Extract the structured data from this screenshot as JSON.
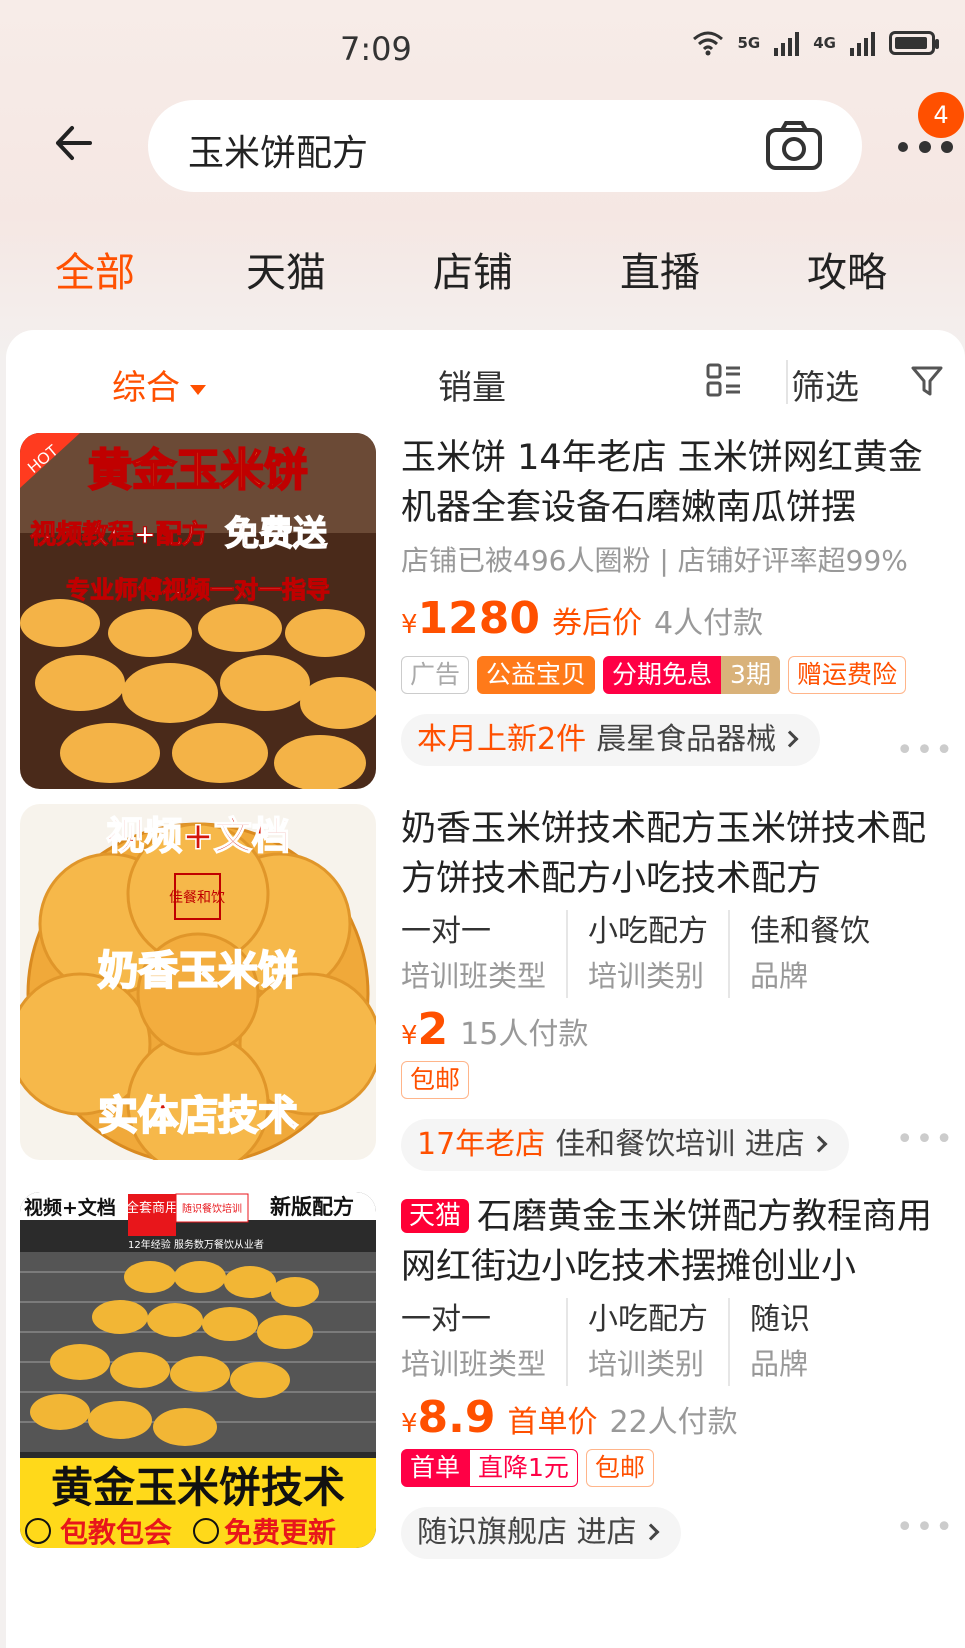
{
  "status": {
    "time": "7:09",
    "net1": "5G",
    "net2": "4G"
  },
  "search": {
    "query": "玉米饼配方",
    "badge": "4"
  },
  "tabs": [
    "全部",
    "天猫",
    "店铺",
    "直播",
    "攻略"
  ],
  "sortbar": {
    "comprehensive": "综合",
    "sales": "销量",
    "filter": "筛选"
  },
  "products": [
    {
      "title": "玉米饼 14年老店 玉米饼网红黄金机器全套设备石磨嫩南瓜饼摆",
      "subline": "店铺已被496人圈粉 | 店铺好评率超99%",
      "yen": "¥",
      "price": "1280",
      "price_label": "券后价",
      "paid": "4人付款",
      "tags": [
        "广告",
        "公益宝贝",
        "分期免息",
        "3期",
        "赠运费险"
      ],
      "shop_highlight": "本月上新2件",
      "shop_name": "晨星食品器械",
      "thumb": {
        "hot": "HOT",
        "line1": "黄金玉米饼",
        "line2a": "视频教程+配方",
        "line2b": "免费送",
        "line3": "专业师傅视频一对一指导"
      }
    },
    {
      "title": "奶香玉米饼技术配方玉米饼技术配方饼技术配方小吃技术配方",
      "attrs": [
        {
          "v": "一对一",
          "k": "培训班类型"
        },
        {
          "v": "小吃配方",
          "k": "培训类别"
        },
        {
          "v": "佳和餐饮",
          "k": "品牌"
        }
      ],
      "yen": "¥",
      "price": "2",
      "paid": "15人付款",
      "tags": [
        "包邮"
      ],
      "shop_highlight": "17年老店",
      "shop_name": "佳和餐饮培训 进店",
      "thumb": {
        "top": "视频+文档",
        "seal": "佳餐和饮",
        "mid": "奶香玉米饼",
        "bottom": "实体店技术"
      }
    },
    {
      "tmall": "天猫",
      "title": "石磨黄金玉米饼配方教程商用网红街边小吃技术摆摊创业小",
      "attrs": [
        {
          "v": "一对一",
          "k": "培训班类型"
        },
        {
          "v": "小吃配方",
          "k": "培训类别"
        },
        {
          "v": "随识",
          "k": "品牌"
        }
      ],
      "yen": "¥",
      "price": "8.9",
      "price_label": "首单价",
      "paid": "22人付款",
      "tags": [
        "首单",
        "直降1元",
        "包邮"
      ],
      "shop_name": "随识旗舰店 进店",
      "thumb": {
        "tl": "视频+文档",
        "mid1": "全套商用",
        "mid2": "随识餐饮培训",
        "tr": "新版配方",
        "sub": "12年经验 服务数万餐饮从业者",
        "big": "黄金玉米饼技术",
        "foot1": "包教包会",
        "foot2": "免费更新"
      }
    }
  ]
}
